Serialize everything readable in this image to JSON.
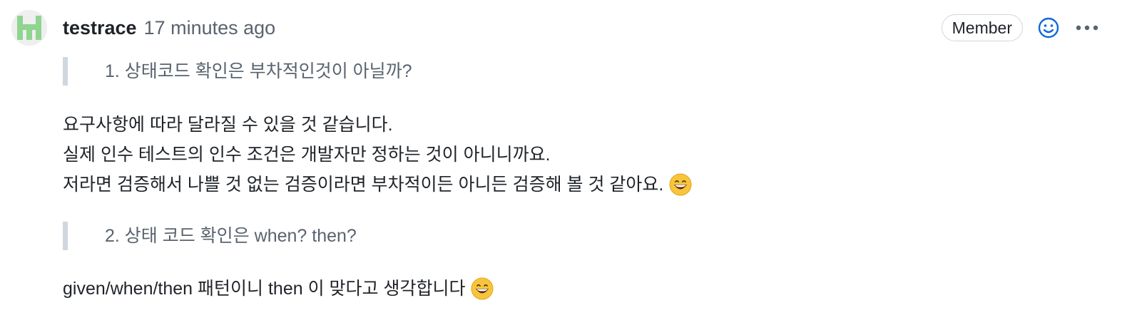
{
  "comment": {
    "author": "testrace",
    "time": "17 minutes ago",
    "badge": "Member",
    "quote1": "1. 상태코드 확인은 부차적인것이 아닐까?",
    "para1": [
      "요구사항에 따라 달라질 수 있을 것 같습니다.",
      "실제 인수 테스트의 인수 조건은 개발자만 정하는 것이 아니니까요.",
      "저라면 검증해서 나쁠 것 없는 검증이라면 부차적이든 아니든 검증해 볼 것 같아요."
    ],
    "quote2": "2. 상태 코드 확인은 when? then?",
    "para2": "given/when/then 패턴이니 then 이 맞다고 생각합니다"
  },
  "icons": {
    "avatar": "identicon-avatar",
    "reaction": "smiley-icon",
    "more": "kebab-horizontal-icon",
    "emoji": "grinning-face-emoji"
  },
  "colors": {
    "reaction_icon": "#0969da",
    "avatar_fill": "#8fd48f",
    "quote_border": "#d0d7de",
    "muted_text": "#59636e"
  }
}
